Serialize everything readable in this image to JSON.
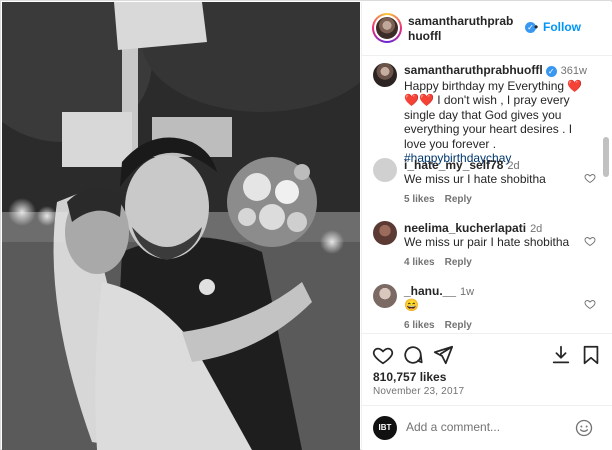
{
  "post": {
    "username": "samantharuthprabhuoffl",
    "follow_label": "Follow",
    "dot": "•",
    "more_label": "···",
    "caption": {
      "username": "samantharuthprabhuoffl",
      "time_ago": "361w",
      "text": "Happy birthday my Everything ❤️❤️❤️ I don't wish , I pray every single day that God gives you everything your heart desires . I love you forever .",
      "hashtag": "#happybirthdaychay"
    },
    "comments": [
      {
        "username": "i_hate_my_self78",
        "time_ago": "2d",
        "text": "We miss ur I hate shobitha",
        "likes": "5 likes",
        "reply": "Reply"
      },
      {
        "username": "neelima_kucherlapati",
        "time_ago": "2d",
        "text": "We miss ur pair I hate shobitha",
        "likes": "4 likes",
        "reply": "Reply"
      },
      {
        "username": "_hanu.__",
        "time_ago": "1w",
        "text": "😄",
        "likes": "6 likes",
        "reply": "Reply"
      }
    ],
    "likes_count": "810,757 likes",
    "date": "November 23, 2017",
    "add_comment": {
      "avatar_text": "IBT",
      "placeholder": "Add a comment..."
    }
  },
  "icons": [
    "heart-icon",
    "comment-icon",
    "share-icon",
    "save-icon",
    "emoji-icon",
    "verified-badge"
  ],
  "colors": {
    "follow_blue": "#0095f6",
    "verified_blue": "#3897f0",
    "hashtag": "#00376b",
    "muted": "#737373"
  }
}
